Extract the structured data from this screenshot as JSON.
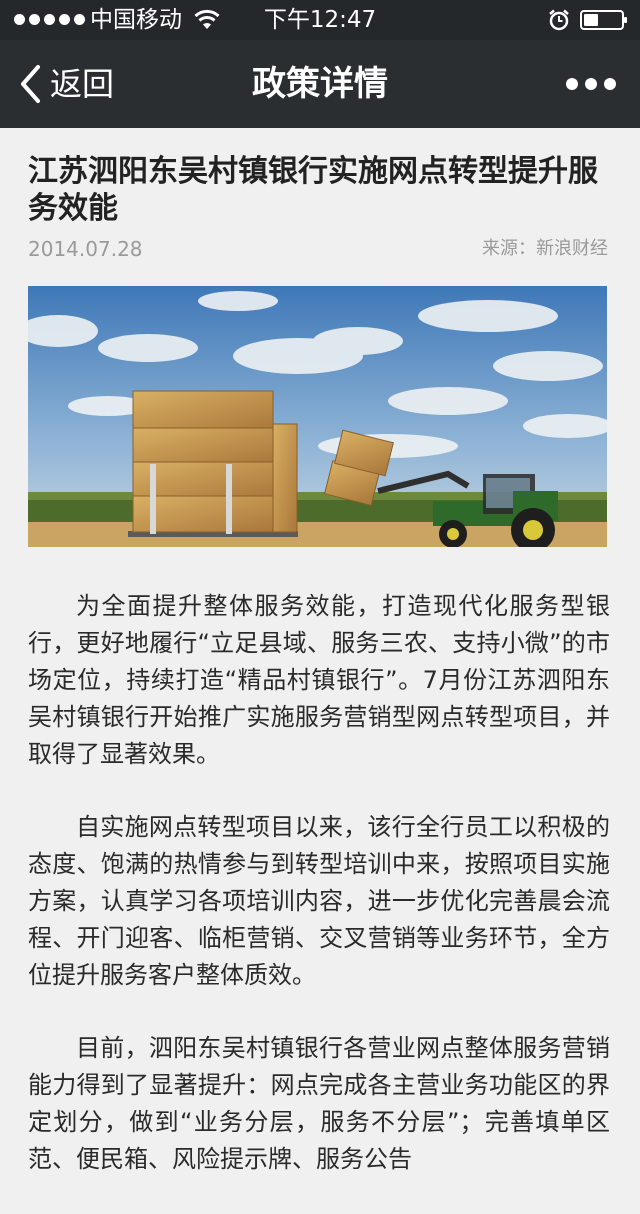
{
  "status_bar": {
    "carrier": "中国移动",
    "time": "下午12:47"
  },
  "nav": {
    "back_label": "返回",
    "title": "政策详情"
  },
  "article": {
    "title": "江苏泗阳东吴村镇银行实施网点转型提升服务效能",
    "date": "2014.07.28",
    "source": "来源：新浪财经",
    "image_alt": "tractor lifting hay bales in a field",
    "paragraphs": [
      "为全面提升整体服务效能，打造现代化服务型银行，更好地履行“立足县域、服务三农、支持小微”的市场定位，持续打造“精品村镇银行”。7月份江苏泗阳东吴村镇银行开始推广实施服务营销型网点转型项目，并取得了显著效果。",
      "自实施网点转型项目以来，该行全行员工以积极的态度、饱满的热情参与到转型培训中来，按照项目实施方案，认真学习各项培训内容，进一步优化完善晨会流程、开门迎客、临柜营销、交叉营销等业务环节，全方位提升服务客户整体质效。",
      "目前，泗阳东吴村镇银行各营业网点整体服务营销能力得到了显著提升：网点完成各主营业务功能区的界定划分，做到“业务分层，服务不分层”；完善填单区范、便民箱、风险提示牌、服务公告"
    ]
  }
}
